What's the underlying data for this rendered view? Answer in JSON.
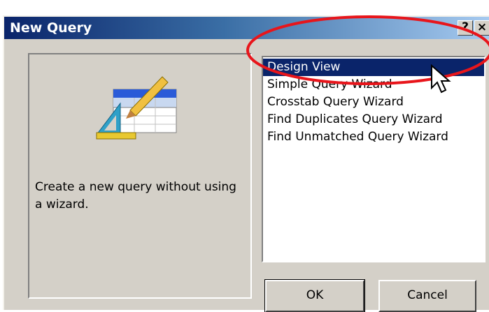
{
  "dialog": {
    "title": "New Query",
    "help_glyph": "?",
    "close_glyph": "×",
    "icons": {
      "help": "help-icon",
      "close": "close-icon",
      "preview": "query-design-icon",
      "cursor": "mouse-pointer-icon"
    }
  },
  "preview": {
    "description": "Create a new query without using a wizard."
  },
  "wizard_list": {
    "items": [
      {
        "label": "Design View",
        "selected": true
      },
      {
        "label": "Simple Query Wizard",
        "selected": false
      },
      {
        "label": "Crosstab Query Wizard",
        "selected": false
      },
      {
        "label": "Find Duplicates Query Wizard",
        "selected": false
      },
      {
        "label": "Find Unmatched Query Wizard",
        "selected": false
      }
    ]
  },
  "buttons": {
    "ok_label": "OK",
    "cancel_label": "Cancel"
  },
  "colors": {
    "title_bar": "#0a246a",
    "selection": "#0a246a",
    "annotation": "#e8151b",
    "dialog_face": "#d4d0c8"
  }
}
